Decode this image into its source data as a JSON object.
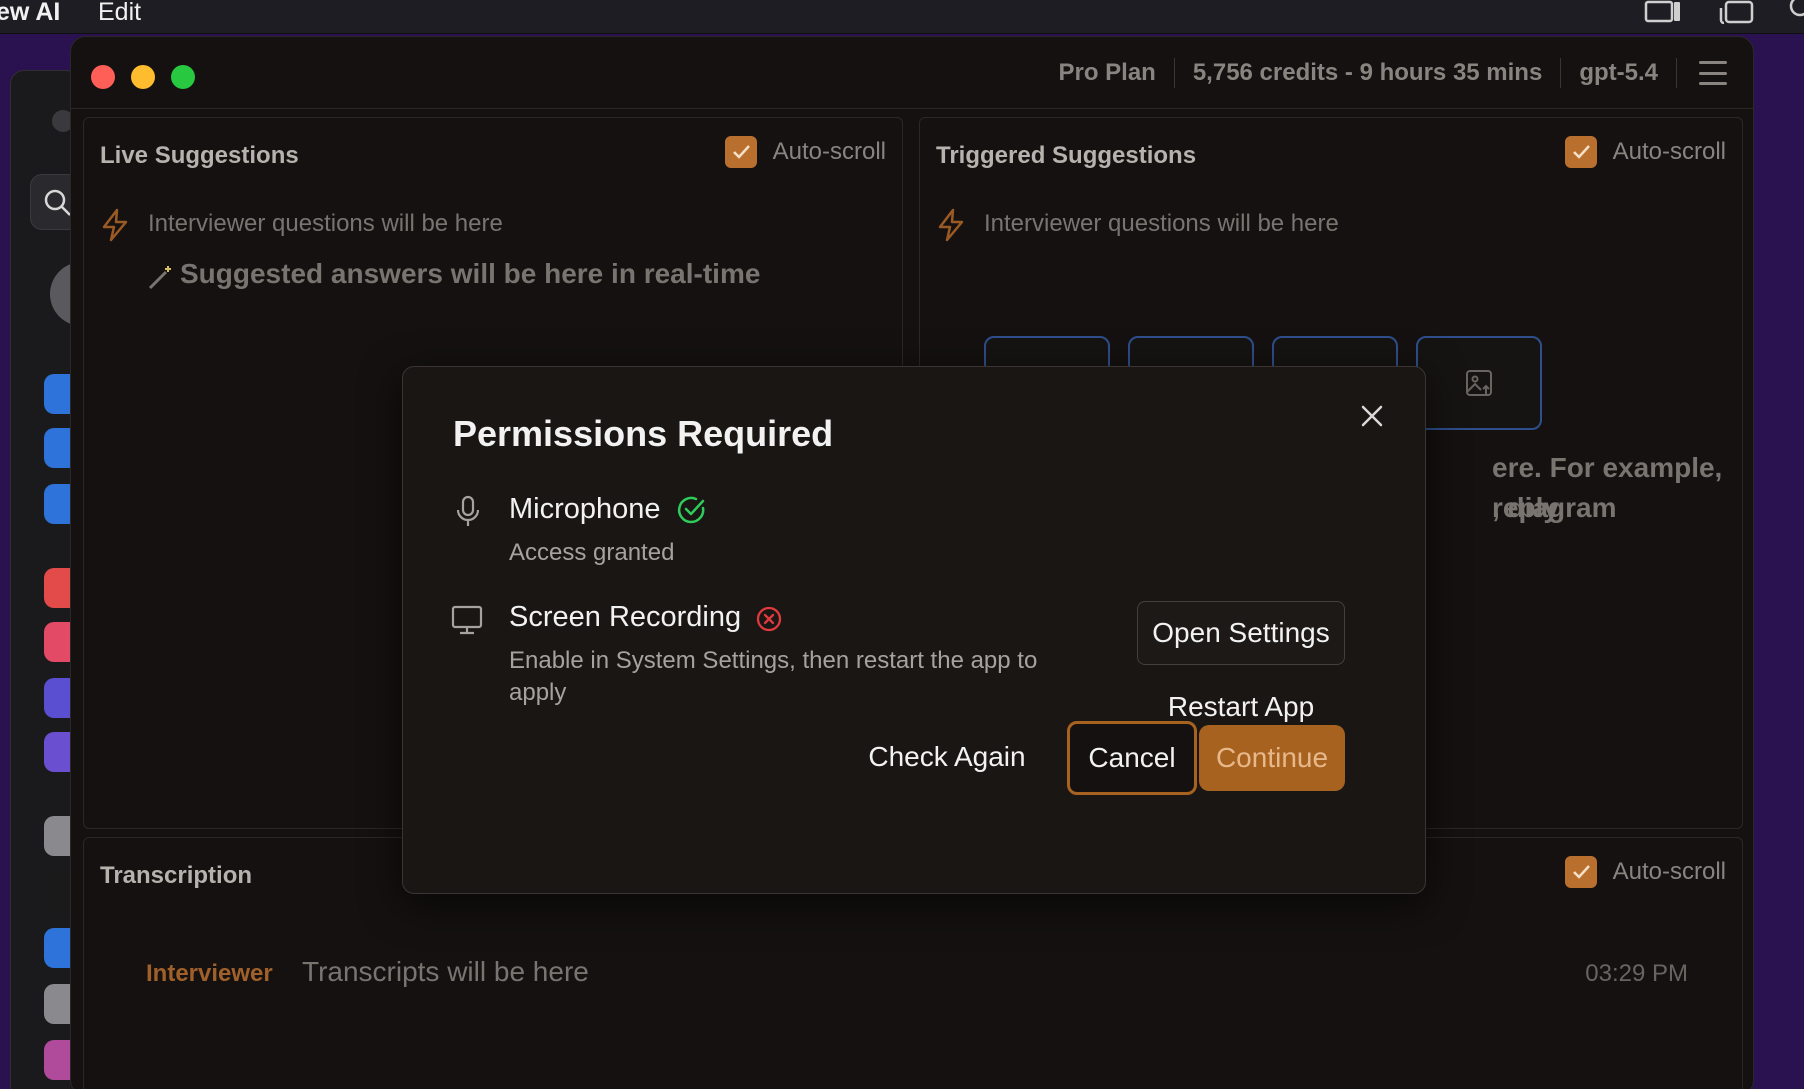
{
  "menubar": {
    "app_name": "ew AI",
    "edit": "Edit"
  },
  "window": {
    "plan": "Pro Plan",
    "credits": "5,756 credits - 9 hours 35 mins",
    "model": "gpt-5.4"
  },
  "live": {
    "title": "Live Suggestions",
    "autoscroll": "Auto-scroll",
    "question_placeholder": "Interviewer questions will be here",
    "answer_placeholder": "Suggested answers will be here in real-time"
  },
  "triggered": {
    "title": "Triggered Suggestions",
    "autoscroll": "Auto-scroll",
    "question_placeholder": "Interviewer questions will be here",
    "hint_line1": "ere. For example, reply",
    "hint_line2": ", diagram"
  },
  "transcription": {
    "title": "Transcription",
    "autoscroll": "Auto-scroll",
    "speaker": "Interviewer",
    "placeholder": "Transcripts will be here",
    "time": "03:29 PM"
  },
  "modal": {
    "title": "Permissions Required",
    "microphone": {
      "name": "Microphone",
      "desc": "Access granted"
    },
    "screen": {
      "name": "Screen Recording",
      "desc_line1": "Enable in System Settings, then restart the app to",
      "desc_line2": "apply"
    },
    "open_settings": "Open Settings",
    "restart_app": "Restart App",
    "check_again": "Check Again",
    "cancel": "Cancel",
    "continue": "Continue"
  },
  "colors": {
    "accent": "#a8621f",
    "granted": "#2ecc5a",
    "denied": "#e0393e"
  }
}
